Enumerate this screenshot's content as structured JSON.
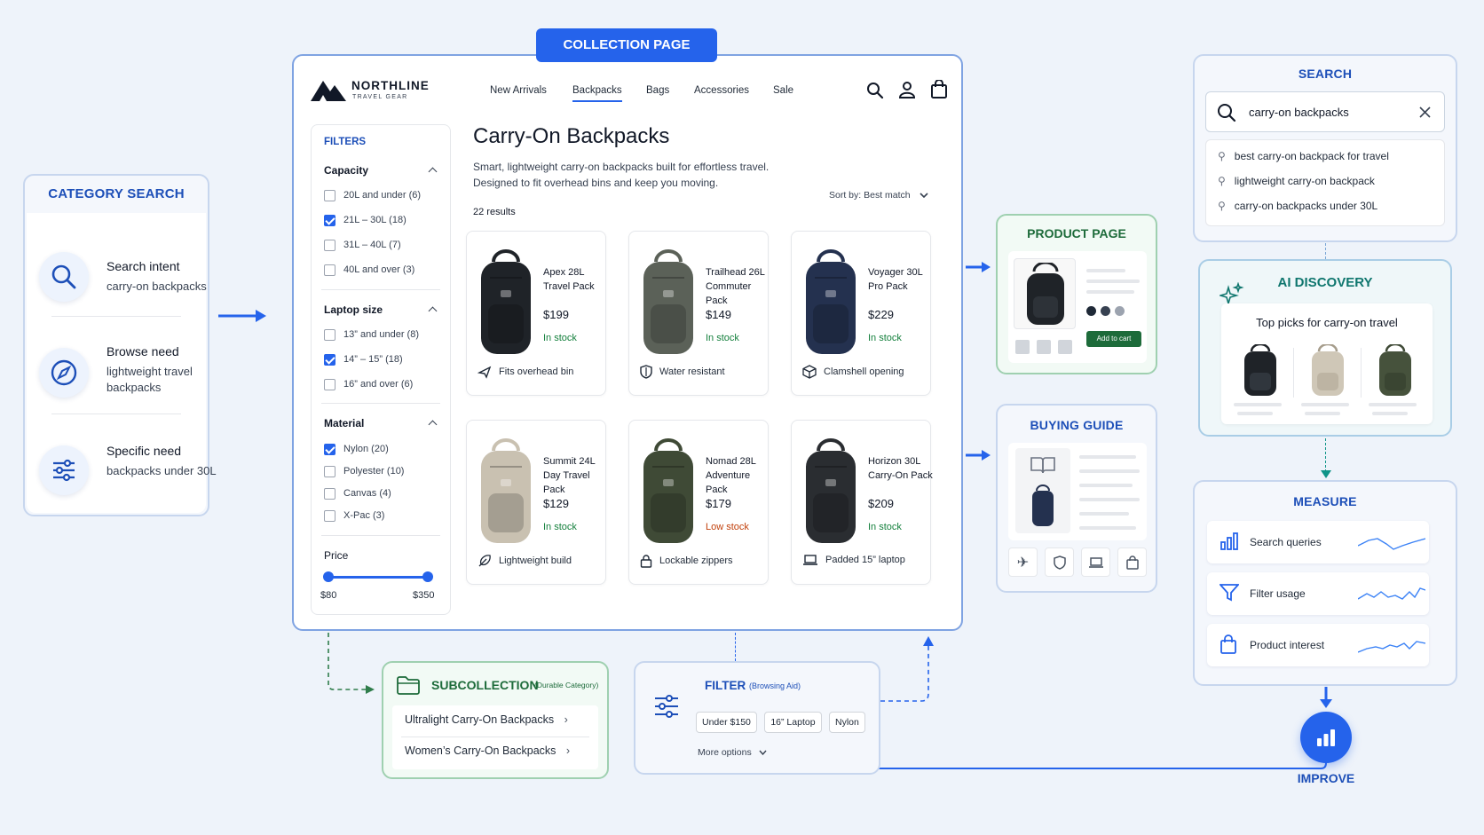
{
  "category_search": {
    "title": "CATEGORY SEARCH",
    "items": [
      {
        "heading": "Search intent",
        "sub": "carry-on backpacks",
        "icon": "search-icon"
      },
      {
        "heading": "Browse need",
        "sub": "lightweight travel backpacks",
        "icon": "compass-icon"
      },
      {
        "heading": "Specific need",
        "sub": "backpacks under 30L",
        "icon": "sliders-icon"
      }
    ]
  },
  "collection": {
    "tag": "COLLECTION PAGE",
    "brand": {
      "name": "NORTHLINE",
      "tagline": "TRAVEL GEAR"
    },
    "nav": [
      "New Arrivals",
      "Backpacks",
      "Bags",
      "Accessories",
      "Sale"
    ],
    "title": "Carry-On Backpacks",
    "description_1": "Smart, lightweight carry-on backpacks built for effortless travel.",
    "description_2": "Designed to fit overhead bins and keep you moving.",
    "results": "22 results",
    "sort": "Sort by: Best match",
    "filters": {
      "title": "FILTERS",
      "capacity": {
        "label": "Capacity",
        "options": [
          {
            "text": "20L and under (6)",
            "checked": false
          },
          {
            "text": "21L – 30L (18)",
            "checked": true
          },
          {
            "text": "31L – 40L (7)",
            "checked": false
          },
          {
            "text": "40L and over (3)",
            "checked": false
          }
        ]
      },
      "laptop": {
        "label": "Laptop size",
        "options": [
          {
            "text": "13” and under (8)",
            "checked": false
          },
          {
            "text": "14” – 15” (18)",
            "checked": true
          },
          {
            "text": "16” and over (6)",
            "checked": false
          }
        ]
      },
      "material": {
        "label": "Material",
        "options": [
          {
            "text": "Nylon (20)",
            "checked": true
          },
          {
            "text": "Polyester (10)",
            "checked": false
          },
          {
            "text": "Canvas (4)",
            "checked": false
          },
          {
            "text": "X-Pac (3)",
            "checked": false
          }
        ]
      },
      "price": {
        "label": "Price",
        "min": "$80",
        "max": "$350"
      }
    },
    "products": [
      {
        "name": "Apex 28L Travel Pack",
        "price": "$199",
        "stock": "In stock",
        "low": false,
        "feature": "Fits overhead bin",
        "feature_icon": "plane-icon",
        "color": "#1f2328"
      },
      {
        "name": "Trailhead 26L Commuter Pack",
        "price": "$149",
        "stock": "In stock",
        "low": false,
        "feature": "Water resistant",
        "feature_icon": "shield-icon",
        "color": "#5b6158"
      },
      {
        "name": "Voyager 30L Pro Pack",
        "price": "$229",
        "stock": "In stock",
        "low": false,
        "feature": "Clamshell opening",
        "feature_icon": "box-icon",
        "color": "#24314f"
      },
      {
        "name": "Summit 24L Day Travel Pack",
        "price": "$129",
        "stock": "In stock",
        "low": false,
        "feature": "Lightweight build",
        "feature_icon": "feather-icon",
        "color": "#c9c1b1"
      },
      {
        "name": "Nomad 28L Adventure Pack",
        "price": "$179",
        "stock": "Low stock",
        "low": true,
        "feature": "Lockable zippers",
        "feature_icon": "lock-icon",
        "color": "#3f4a36"
      },
      {
        "name": "Horizon 30L Carry-On Pack",
        "price": "$209",
        "stock": "In stock",
        "low": false,
        "feature": "Padded 15” laptop",
        "feature_icon": "laptop-icon",
        "color": "#2a2d31"
      }
    ]
  },
  "product_page": {
    "title": "PRODUCT PAGE",
    "cta": "Add to cart"
  },
  "buying_guide": {
    "title": "BUYING GUIDE"
  },
  "search_panel": {
    "title": "SEARCH",
    "query": "carry-on backpacks",
    "suggestions": [
      "best carry-on backpack for travel",
      "lightweight carry-on backpack",
      "carry-on backpacks under 30L"
    ]
  },
  "ai_discovery": {
    "title": "AI DISCOVERY",
    "heading": "Top picks for carry-on travel"
  },
  "measure": {
    "title": "MEASURE",
    "rows": [
      "Search queries",
      "Filter usage",
      "Product interest"
    ]
  },
  "improve": {
    "label": "IMPROVE"
  },
  "subcollection": {
    "title": "SUBCOLLECTION",
    "note": "(Durable Category)",
    "items": [
      "Ultralight Carry-On Backpacks",
      "Women’s Carry-On Backpacks"
    ]
  },
  "filter_panel": {
    "title": "FILTER",
    "note": "(Browsing Aid)",
    "chips": [
      "Under $150",
      "16” Laptop",
      "Nylon"
    ],
    "more": "More options"
  },
  "colors": {
    "accent": "#2563eb",
    "green": "#1d6b3a",
    "in_stock": "#15803d",
    "low_stock": "#c2410c"
  }
}
